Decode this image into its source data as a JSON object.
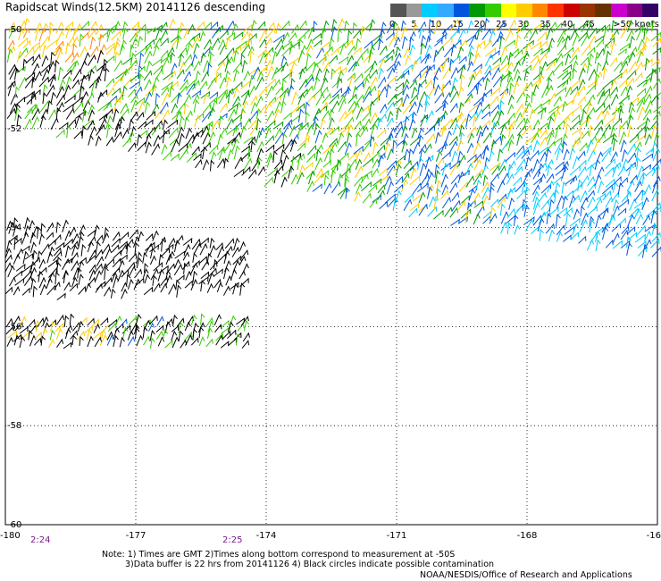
{
  "title": "Rapidscat Winds(12.5KM) 20141126 descending",
  "colorbar": {
    "units_label": ">50 knots",
    "ticks": [
      "0",
      "5",
      "10",
      "15",
      "20",
      "25",
      "30",
      "35",
      "40",
      "45"
    ],
    "colors": [
      "#555555",
      "#999999",
      "#00ccff",
      "#33aaff",
      "#0055dd",
      "#009900",
      "#33cc00",
      "#ffff00",
      "#ffcc00",
      "#ff8800",
      "#ff3300",
      "#cc0000",
      "#993300",
      "#663300",
      "#cc00cc",
      "#880088",
      "#330066"
    ]
  },
  "map": {
    "x_ticks": [
      "-180",
      "-177",
      "-174",
      "-171",
      "-168",
      "-16"
    ],
    "y_ticks": [
      "-50",
      "-52",
      "-54",
      "-56",
      "-58",
      "-60"
    ],
    "lon_range": [
      -180,
      -165
    ],
    "lat_range": [
      -60,
      -50
    ]
  },
  "times": [
    {
      "label": "2:24"
    },
    {
      "label": "2:25"
    }
  ],
  "notes": {
    "line1": "Note: 1) Times are GMT 2)Times along bottom correspond to measurement at -50S",
    "line2": "3)Data buffer is 22 hrs from 20141126 4) Black circles indicate possible contamination"
  },
  "credit": "NOAA/NESDIS/Office of Research and Applications"
}
